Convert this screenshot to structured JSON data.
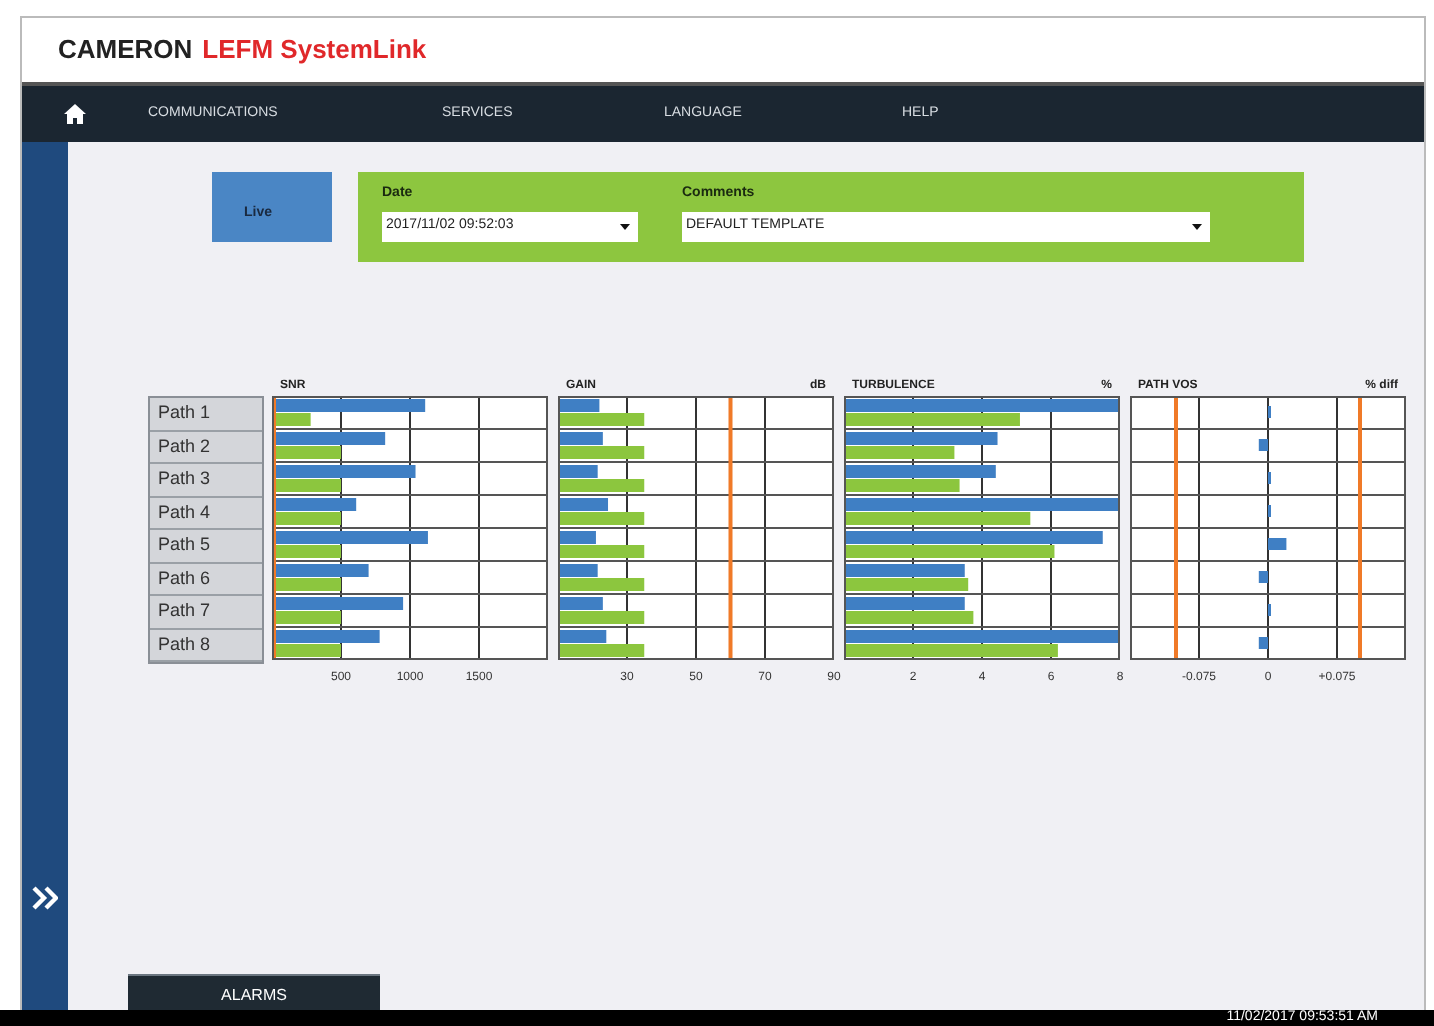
{
  "app": {
    "brand": "CAMERON",
    "product": "LEFM SystemLink"
  },
  "nav": {
    "items": [
      "COMMUNICATIONS",
      "SERVICES",
      "LANGUAGE",
      "HELP"
    ]
  },
  "live": {
    "label": "Live"
  },
  "filters": {
    "date": {
      "label": "Date",
      "value": "2017/11/02 09:52:03"
    },
    "comments": {
      "label": "Comments",
      "value": "DEFAULT TEMPLATE"
    }
  },
  "charts": [
    {
      "chart_data": {
        "type": "bar",
        "orientation": "horizontal",
        "title": "SNR",
        "categories": [
          "Path 1",
          "Path 2",
          "Path 3",
          "Path 4",
          "Path 5",
          "Path 6",
          "Path 7",
          "Path 8"
        ],
        "xlim": [
          0,
          2000
        ],
        "xticks": [
          500,
          1000,
          1500
        ],
        "series": [
          {
            "color": "#3f7fc4",
            "values": [
              1110,
              820,
              1040,
              610,
              1130,
              700,
              950,
              780
            ]
          },
          {
            "color": "#8cc63e",
            "values": [
              280,
              500,
              500,
              500,
              500,
              500,
              500,
              500
            ]
          }
        ],
        "grid": true,
        "ref_lines": [
          {
            "axis": "x",
            "value": 0
          }
        ]
      }
    },
    {
      "unit": "dB",
      "chart_data": {
        "type": "bar",
        "orientation": "horizontal",
        "title": "GAIN",
        "xlim": [
          10,
          90
        ],
        "xticks": [
          30,
          50,
          70,
          90
        ],
        "series": [
          {
            "color": "#3f7fc4",
            "values": [
              22,
              23,
              21.5,
              24.5,
              21,
              21.5,
              23,
              24
            ]
          },
          {
            "color": "#8cc63e",
            "values": [
              35,
              35,
              35,
              35,
              35,
              35,
              35,
              35
            ]
          }
        ],
        "grid": true,
        "ref_lines": [
          {
            "axis": "x",
            "value": 60
          }
        ]
      }
    },
    {
      "unit": "%",
      "chart_data": {
        "type": "bar",
        "orientation": "horizontal",
        "title": "TURBULENCE",
        "xlim": [
          0,
          8
        ],
        "xticks": [
          2,
          4,
          6,
          8
        ],
        "series": [
          {
            "color": "#3f7fc4",
            "values": [
              8,
              4.45,
              4.4,
              8,
              7.5,
              3.5,
              3.5,
              8
            ]
          },
          {
            "color": "#8cc63e",
            "values": [
              5.1,
              3.2,
              3.35,
              5.4,
              6.1,
              3.6,
              3.75,
              6.2
            ]
          }
        ],
        "grid": true
      }
    },
    {
      "unit": "% diff",
      "chart_data": {
        "type": "bar",
        "orientation": "horizontal",
        "title": "PATH VOS",
        "xlim": [
          -0.15,
          0.15
        ],
        "xticks": [
          {
            "value": -0.075,
            "label": "-0.075"
          },
          {
            "value": 0,
            "label": "0"
          },
          {
            "value": 0.075,
            "label": "+0.075"
          }
        ],
        "series": [
          {
            "color": "#3f7fc4",
            "values": [
              0,
              -0.01,
              0.002,
              0.002,
              0.02,
              -0.01,
              0,
              -0.01
            ]
          }
        ],
        "grid": true,
        "ref_lines": [
          {
            "axis": "x",
            "value": -0.1
          },
          {
            "axis": "x",
            "value": 0.1
          }
        ]
      }
    }
  ],
  "alarms_button": "ALARMS",
  "status_bar": {
    "timestamp": "11/02/2017 09:53:51 AM"
  }
}
